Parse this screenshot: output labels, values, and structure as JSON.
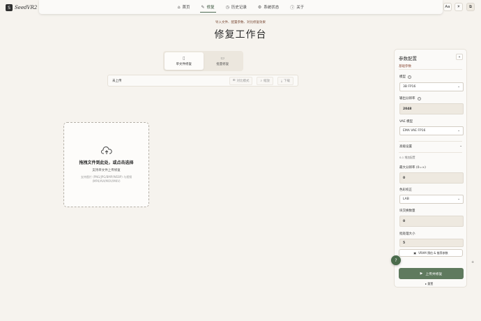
{
  "brand": {
    "logo_text": "S",
    "name": "SeedVR2"
  },
  "nav": {
    "items": [
      {
        "icon": "⌂",
        "label": "首页"
      },
      {
        "icon": "✎",
        "label": "修复"
      },
      {
        "icon": "◷",
        "label": "历史记录"
      },
      {
        "icon": "⚙",
        "label": "系统状态"
      },
      {
        "icon": "ⓘ",
        "label": "关于"
      }
    ],
    "active_index": 1
  },
  "header_buttons": {
    "font_size": "Aa",
    "theme": "☀",
    "panel": "⧉"
  },
  "page": {
    "subtitle": "导入文件、配置参数、对比修复效果",
    "title": "修复工作台"
  },
  "mode_switch": {
    "single": {
      "icon": "▯",
      "label": "单文件修复"
    },
    "batch": {
      "icon": "▭",
      "label": "批量修复"
    }
  },
  "toolbar": {
    "status": "未上传",
    "compare_label": "对比模式",
    "zoom_label": "缩放",
    "download_label": "下载"
  },
  "dropzone": {
    "title": "拖拽文件到此处，或点击选择",
    "sub": "支持单文件上传修复",
    "hint": "支持图片 (PNG/JPG/BMP/WEBP) 与视频 (MP4/AVI/MOV/MKV)"
  },
  "panel": {
    "title": "参数配置",
    "collapse_icon": "«",
    "section_basic": "基础参数",
    "model_label": "模型",
    "model_value": "3B FP16",
    "output_res_label": "输出分辨率",
    "output_res_value": "2048",
    "vae_label": "VAE 模型",
    "vae_value": "EMA VAE FP16",
    "advanced_label": "高级设置",
    "advanced_icon": "⌄",
    "tiny_note": "0-1 增加配置",
    "max_res_label": "最大分辨率 (0=∞)",
    "max_res_value": "0",
    "color_label": "色彩校正",
    "color_value": "LAB",
    "blocks_label": "块交换数量",
    "blocks_value": "0",
    "batch_label": "批处理大小",
    "batch_value": "5",
    "vram_label": "VRAM 预估 & 推荐参数",
    "run_label": "上传并修复",
    "reset_label": "重置"
  },
  "colors": {
    "accent": "#5f7a5e",
    "accent_text": "#8a4a35",
    "background": "#f6f3ee"
  }
}
